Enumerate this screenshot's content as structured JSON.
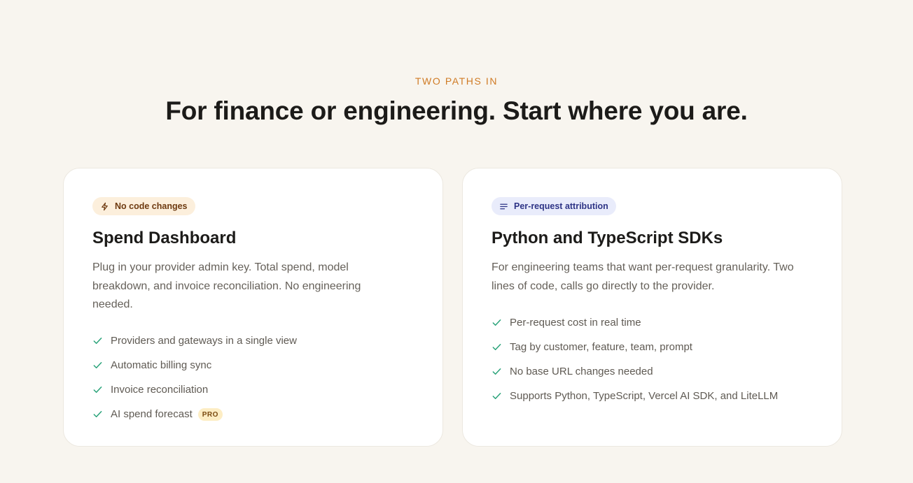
{
  "section": {
    "eyebrow": "TWO PATHS IN",
    "headline": "For finance or engineering. Start where you are."
  },
  "cards": [
    {
      "badge": "No code changes",
      "badge_icon": "lightning-icon",
      "title": "Spend Dashboard",
      "description": "Plug in your provider admin key. Total spend, model breakdown, and invoice reconciliation. No engineering needed.",
      "features": [
        "Providers and gateways in a single view",
        "Automatic billing sync",
        "Invoice reconciliation",
        "AI spend forecast"
      ],
      "pro_label": "PRO"
    },
    {
      "badge": "Per-request attribution",
      "badge_icon": "lines-icon",
      "title": "Python and TypeScript SDKs",
      "description": "For engineering teams that want per-request granularity. Two lines of code, calls go directly to the provider.",
      "features": [
        "Per-request cost in real time",
        "Tag by customer, feature, team, prompt",
        "No base URL changes needed",
        "Supports Python, TypeScript, Vercel AI SDK, and LiteLLM"
      ]
    }
  ],
  "colors": {
    "background": "#f8f5ef",
    "accent_orange": "#d07b25",
    "check_green": "#2aa37a",
    "pill_orange_bg": "#fcefdc",
    "pill_blue_bg": "#e9ecfb"
  }
}
